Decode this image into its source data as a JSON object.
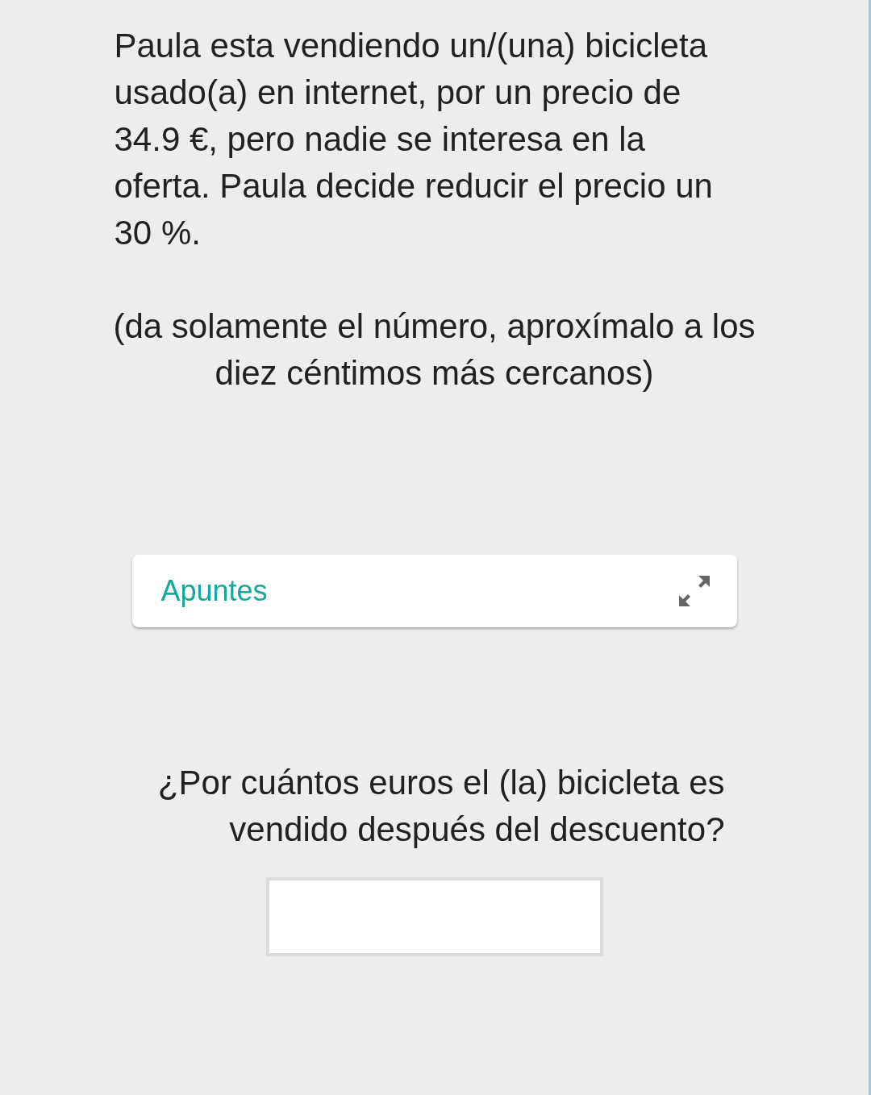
{
  "problem": "Paula esta vendiendo un/(una) bicicleta usado(a) en internet, por un precio de 34.9 €, pero nadie se interesa en la oferta. Paula decide reducir el precio un 30 %.",
  "hint": "(da solamente el número, aproxímalo a los diez céntimos más cercanos)",
  "notes": {
    "title": "Apuntes"
  },
  "question": "¿Por cuántos euros el (la) bicicleta es vendido después del descuento?"
}
